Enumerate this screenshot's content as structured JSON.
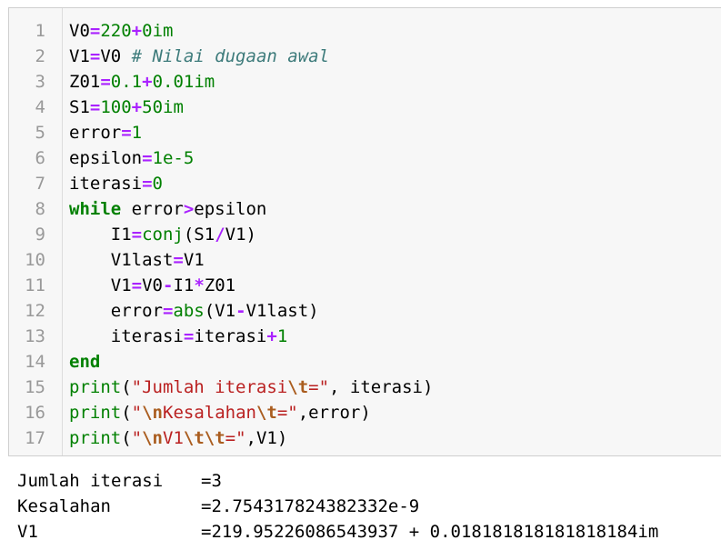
{
  "code_cell": {
    "lines": [
      {
        "n": "1",
        "tokens": [
          [
            "t",
            "V0"
          ],
          [
            "op",
            "="
          ],
          [
            "num",
            "220"
          ],
          [
            "op",
            "+"
          ],
          [
            "num",
            "0im"
          ]
        ]
      },
      {
        "n": "2",
        "tokens": [
          [
            "t",
            "V1"
          ],
          [
            "op",
            "="
          ],
          [
            "t",
            "V0 "
          ],
          [
            "cmt",
            "# Nilai dugaan awal"
          ]
        ]
      },
      {
        "n": "3",
        "tokens": [
          [
            "t",
            "Z01"
          ],
          [
            "op",
            "="
          ],
          [
            "num",
            "0.1"
          ],
          [
            "op",
            "+"
          ],
          [
            "num",
            "0.01im"
          ]
        ]
      },
      {
        "n": "4",
        "tokens": [
          [
            "t",
            "S1"
          ],
          [
            "op",
            "="
          ],
          [
            "num",
            "100"
          ],
          [
            "op",
            "+"
          ],
          [
            "num",
            "50im"
          ]
        ]
      },
      {
        "n": "5",
        "tokens": [
          [
            "t",
            "error"
          ],
          [
            "op",
            "="
          ],
          [
            "num",
            "1"
          ]
        ]
      },
      {
        "n": "6",
        "tokens": [
          [
            "t",
            "epsilon"
          ],
          [
            "op",
            "="
          ],
          [
            "num",
            "1e-5"
          ]
        ]
      },
      {
        "n": "7",
        "tokens": [
          [
            "t",
            "iterasi"
          ],
          [
            "op",
            "="
          ],
          [
            "num",
            "0"
          ]
        ]
      },
      {
        "n": "8",
        "tokens": [
          [
            "kw",
            "while"
          ],
          [
            "t",
            " error"
          ],
          [
            "op",
            ">"
          ],
          [
            "t",
            "epsilon"
          ]
        ]
      },
      {
        "n": "9",
        "tokens": [
          [
            "t",
            "    I1"
          ],
          [
            "op",
            "="
          ],
          [
            "fn",
            "conj"
          ],
          [
            "t",
            "(S1"
          ],
          [
            "op",
            "/"
          ],
          [
            "t",
            "V1)"
          ]
        ]
      },
      {
        "n": "10",
        "tokens": [
          [
            "t",
            "    V1last"
          ],
          [
            "op",
            "="
          ],
          [
            "t",
            "V1"
          ]
        ]
      },
      {
        "n": "11",
        "tokens": [
          [
            "t",
            "    V1"
          ],
          [
            "op",
            "="
          ],
          [
            "t",
            "V0"
          ],
          [
            "op",
            "-"
          ],
          [
            "t",
            "I1"
          ],
          [
            "op",
            "*"
          ],
          [
            "t",
            "Z01"
          ]
        ]
      },
      {
        "n": "12",
        "tokens": [
          [
            "t",
            "    error"
          ],
          [
            "op",
            "="
          ],
          [
            "fn",
            "abs"
          ],
          [
            "t",
            "(V1"
          ],
          [
            "op",
            "-"
          ],
          [
            "t",
            "V1last)"
          ]
        ]
      },
      {
        "n": "13",
        "tokens": [
          [
            "t",
            "    iterasi"
          ],
          [
            "op",
            "="
          ],
          [
            "t",
            "iterasi"
          ],
          [
            "op",
            "+"
          ],
          [
            "num",
            "1"
          ]
        ]
      },
      {
        "n": "14",
        "tokens": [
          [
            "kw",
            "end"
          ]
        ]
      },
      {
        "n": "15",
        "tokens": [
          [
            "fn",
            "print"
          ],
          [
            "t",
            "("
          ],
          [
            "str",
            "\"Jumlah iterasi"
          ],
          [
            "esc",
            "\\t"
          ],
          [
            "str",
            "=\""
          ],
          [
            "t",
            ", iterasi)"
          ]
        ]
      },
      {
        "n": "16",
        "tokens": [
          [
            "fn",
            "print"
          ],
          [
            "t",
            "("
          ],
          [
            "str",
            "\""
          ],
          [
            "esc",
            "\\n"
          ],
          [
            "str",
            "Kesalahan"
          ],
          [
            "esc",
            "\\t"
          ],
          [
            "str",
            "=\""
          ],
          [
            "t",
            ",error)"
          ]
        ]
      },
      {
        "n": "17",
        "tokens": [
          [
            "fn",
            "print"
          ],
          [
            "t",
            "("
          ],
          [
            "str",
            "\""
          ],
          [
            "esc",
            "\\n"
          ],
          [
            "str",
            "V1"
          ],
          [
            "esc",
            "\\t\\t"
          ],
          [
            "str",
            "=\""
          ],
          [
            "t",
            ",V1)"
          ]
        ]
      }
    ]
  },
  "output": {
    "lines": [
      {
        "label": "Jumlah iterasi",
        "value": "=3"
      },
      {
        "label": "Kesalahan",
        "value": "=2.754317824382332e-9"
      },
      {
        "label": "V1",
        "value": "=219.95226086543937 + 0.018181818181818184im"
      }
    ]
  },
  "colors": {
    "operator": "#aa22ff",
    "number": "#008000",
    "comment": "#3d7b7b",
    "keyword": "#008000",
    "builtin": "#008000",
    "string": "#ba2121",
    "escape": "#aa5d1f",
    "line_number": "#999999",
    "cell_background": "#f7f7f7"
  }
}
